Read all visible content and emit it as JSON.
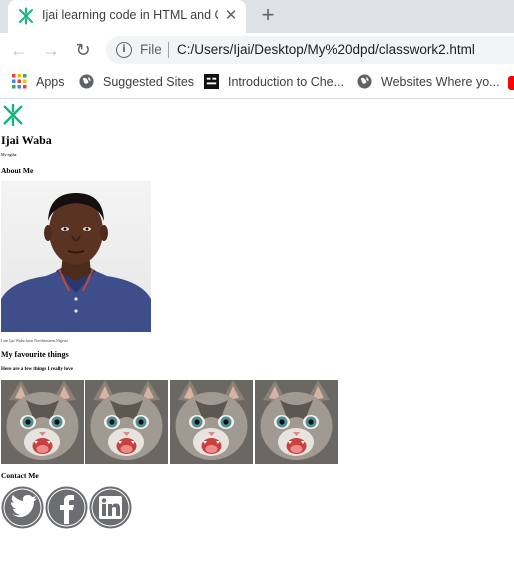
{
  "browser": {
    "tab": {
      "title": "Ijai learning code in HTML and C",
      "close_glyph": "✕",
      "favicon": "green-x-logo-icon"
    },
    "new_tab_glyph": "+",
    "nav": {
      "back_glyph": "←",
      "forward_glyph": "→",
      "reload_glyph": "↻"
    },
    "omnibox": {
      "scheme_label": "File",
      "url": "C:/Users/Ijai/Desktop/My%20dpd/classwork2.html"
    },
    "bookmarks": [
      {
        "label": "Apps",
        "icon": "apps-grid-icon"
      },
      {
        "label": "Suggested Sites",
        "icon": "globe-icon"
      },
      {
        "label": "Introduction to Che...",
        "icon": "book-icon"
      },
      {
        "label": "Websites Where yo...",
        "icon": "globe-icon"
      }
    ]
  },
  "page": {
    "name": "Ijai Waba",
    "tagline": "My ngtha",
    "about_heading": "About Me",
    "bio": "I am Ijai Waba from Northeastern Nigeria",
    "favourite_heading": "My favourite things",
    "favourite_sub": "Here are a few things I really love",
    "contact_heading": "Contact Me",
    "social_icons": [
      "twitter-icon",
      "facebook-icon",
      "linkedin-icon"
    ]
  },
  "colors": {
    "tabstrip": "#dee1e6",
    "logo_green": "#16b17e",
    "social_grey": "#6d6e71"
  }
}
